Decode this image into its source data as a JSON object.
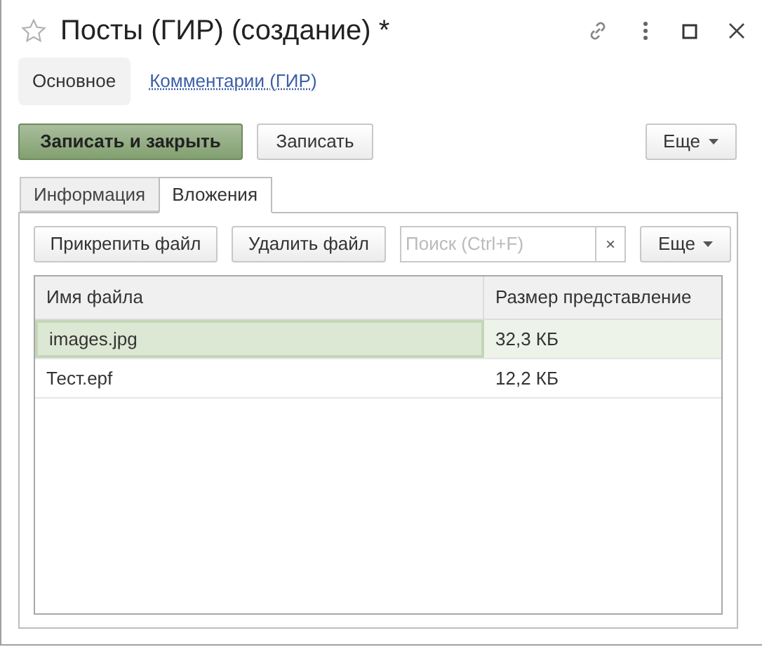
{
  "window": {
    "title": "Посты (ГИР) (создание) *",
    "favorite": false
  },
  "sections": [
    {
      "label": "Основное",
      "selected": true
    },
    {
      "label": "Комментарии (ГИР)",
      "selected": false
    }
  ],
  "toolbar": {
    "buttons": [
      {
        "label": "Записать и закрыть",
        "kind": "primary"
      },
      {
        "label": "Записать",
        "kind": "normal"
      }
    ],
    "more": "Еще"
  },
  "tabs": [
    {
      "label": "Информация",
      "selected": false
    },
    {
      "label": "Вложения",
      "selected": true
    }
  ],
  "attachments": {
    "buttons": [
      "Прикрепить файл",
      "Удалить файл"
    ],
    "search": {
      "placeholder": "Поиск (Ctrl+F)",
      "clear": "×"
    },
    "more": "Еще",
    "table": {
      "columns": [
        "Имя файла",
        "Размер представление"
      ],
      "rows": [
        {
          "cells": [
            "images.jpg",
            "32,3 КБ"
          ],
          "selected": true
        },
        {
          "cells": [
            "Тест.epf",
            "12,2 КБ"
          ],
          "selected": false
        }
      ]
    }
  }
}
